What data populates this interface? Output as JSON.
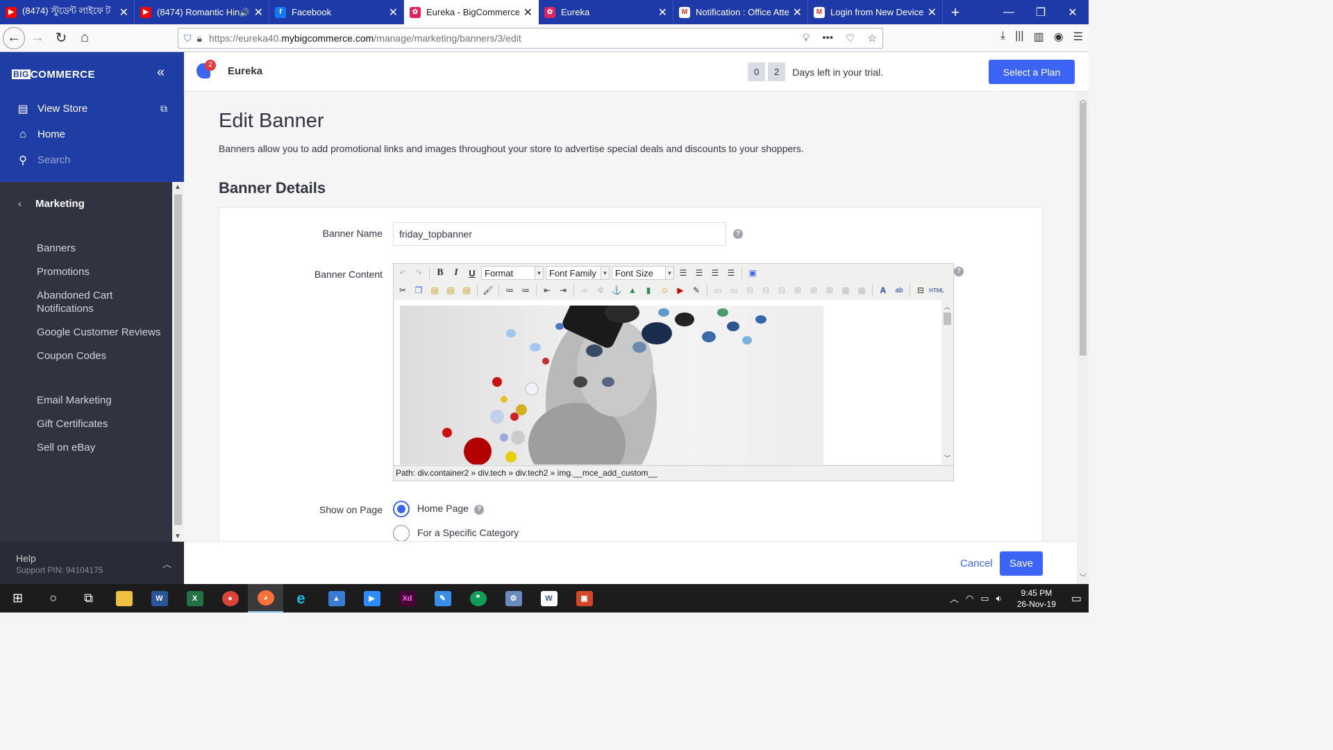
{
  "browser": {
    "tabs": [
      {
        "title": "(8474) স্টুডেন্ট লাইফে ট",
        "icon": "youtube-icon",
        "color": "#ff0000",
        "glyph": "▶",
        "active": false
      },
      {
        "title": "(8474) Romantic Hin",
        "icon": "youtube-icon",
        "color": "#ff0000",
        "glyph": "▶",
        "active": false,
        "audio": "🔊"
      },
      {
        "title": "Facebook",
        "icon": "facebook-icon",
        "color": "#1877f2",
        "glyph": "f",
        "active": false
      },
      {
        "title": "Eureka - BigCommerce",
        "icon": "bigcommerce-icon",
        "color": "#e0245e",
        "glyph": "✿",
        "active": true
      },
      {
        "title": "Eureka",
        "icon": "bigcommerce-icon",
        "color": "#e0245e",
        "glyph": "✿",
        "active": false
      },
      {
        "title": "Notification : Office Atte",
        "icon": "gmail-icon",
        "color": "#d93025",
        "glyph": "M",
        "active": false
      },
      {
        "title": "Login from New Device",
        "icon": "gmail-icon",
        "color": "#d93025",
        "glyph": "M",
        "active": false
      }
    ],
    "url_prefix": "https://eureka40.",
    "url_host": "mybigcommerce.com",
    "url_path": "/manage/marketing/banners/3/edit"
  },
  "sidebar": {
    "brand_big": "BIG",
    "brand_rest": "COMMERCE",
    "view_store": "View Store",
    "home": "Home",
    "search": "Search",
    "section": "Marketing",
    "items": [
      "Banners",
      "Promotions",
      "Abandoned Cart Notifications",
      "Google Customer Reviews",
      "Coupon Codes",
      "Email Marketing",
      "Gift Certificates",
      "Sell on eBay"
    ],
    "help": "Help",
    "support_pin": "Support PIN: 94104175"
  },
  "header": {
    "notification_count": "2",
    "store_name": "Eureka",
    "trial_digits": [
      "0",
      "2"
    ],
    "trial_text": "Days left in your trial.",
    "plan_button": "Select a Plan"
  },
  "page": {
    "title": "Edit Banner",
    "description": "Banners allow you to add promotional links and images throughout your store to advertise special deals and discounts to your shoppers.",
    "section_title": "Banner Details",
    "banner_name_label": "Banner Name",
    "banner_name_value": "friday_topbanner",
    "banner_content_label": "Banner Content",
    "help_glyph": "?",
    "editor": {
      "format": "Format",
      "font_family": "Font Family",
      "font_size": "Font Size",
      "path": "Path: div.container2 » div.tech » div.tech2 » img.__mce_add_custom__"
    },
    "show_on_page_label": "Show on Page",
    "show_on_page_options": [
      "Home Page",
      "For a Specific Category"
    ],
    "selected_option": "Home Page"
  },
  "footer": {
    "cancel": "Cancel",
    "save": "Save"
  },
  "taskbar": {
    "time": "9:45 PM",
    "date": "26-Nov-19"
  }
}
